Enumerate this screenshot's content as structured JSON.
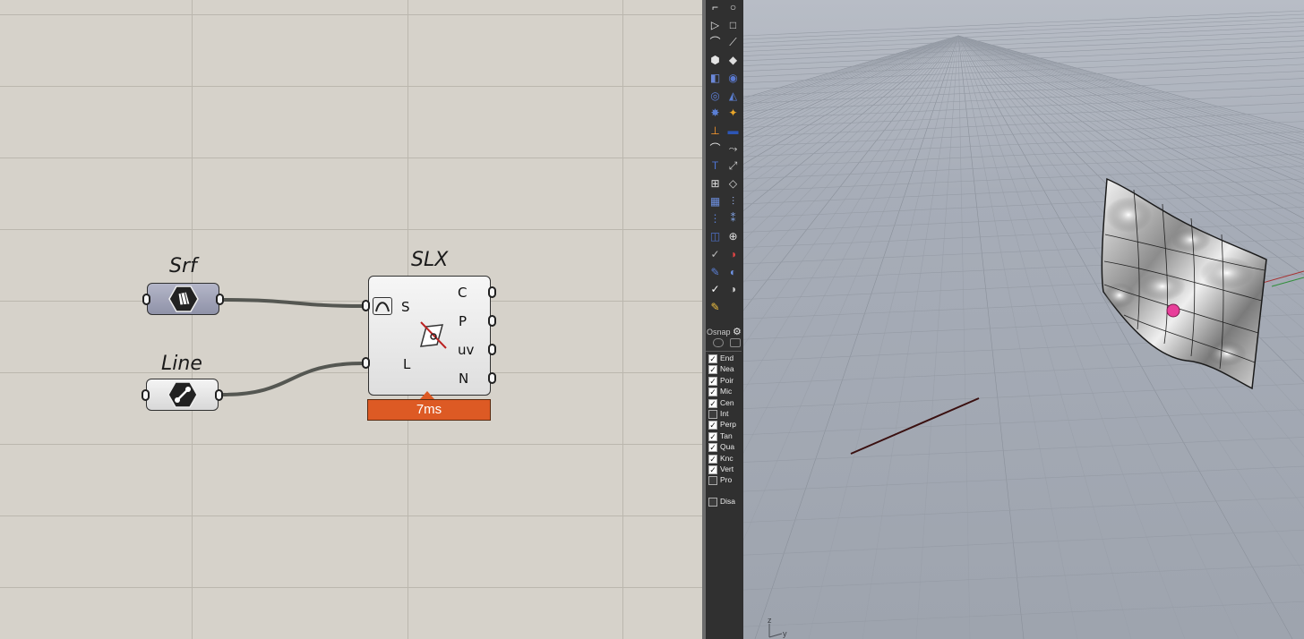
{
  "grasshopper": {
    "params": [
      {
        "id": "srf",
        "nickname": "Srf",
        "icon": "surface-icon"
      },
      {
        "id": "line",
        "nickname": "Line",
        "icon": "line-icon"
      }
    ],
    "component": {
      "nickname": "SLX",
      "inputs": [
        "S",
        "L"
      ],
      "outputs": [
        "C",
        "P",
        "uv",
        "N"
      ],
      "icon": "surface-line-intersect-icon",
      "timer": "7ms",
      "timer_color": "#dd5a24"
    }
  },
  "rhino": {
    "osnap": {
      "title": "Osnap",
      "items": [
        {
          "label": "End",
          "checked": true
        },
        {
          "label": "Nea",
          "checked": true
        },
        {
          "label": "Poir",
          "checked": true
        },
        {
          "label": "Mic",
          "checked": true
        },
        {
          "label": "Cen",
          "checked": true
        },
        {
          "label": "Int",
          "checked": false
        },
        {
          "label": "Perp",
          "checked": true
        },
        {
          "label": "Tan",
          "checked": true
        },
        {
          "label": "Qua",
          "checked": true
        },
        {
          "label": "Knc",
          "checked": true
        },
        {
          "label": "Vert",
          "checked": true
        },
        {
          "label": "Pro",
          "checked": false
        }
      ],
      "disable": {
        "label": "Disa",
        "checked": false
      }
    },
    "viewport": {
      "axis_labels": [
        "z",
        "y"
      ],
      "background": "#a6acb6",
      "point_color": "#e83e9a",
      "curve_color": "#3a1010"
    }
  }
}
